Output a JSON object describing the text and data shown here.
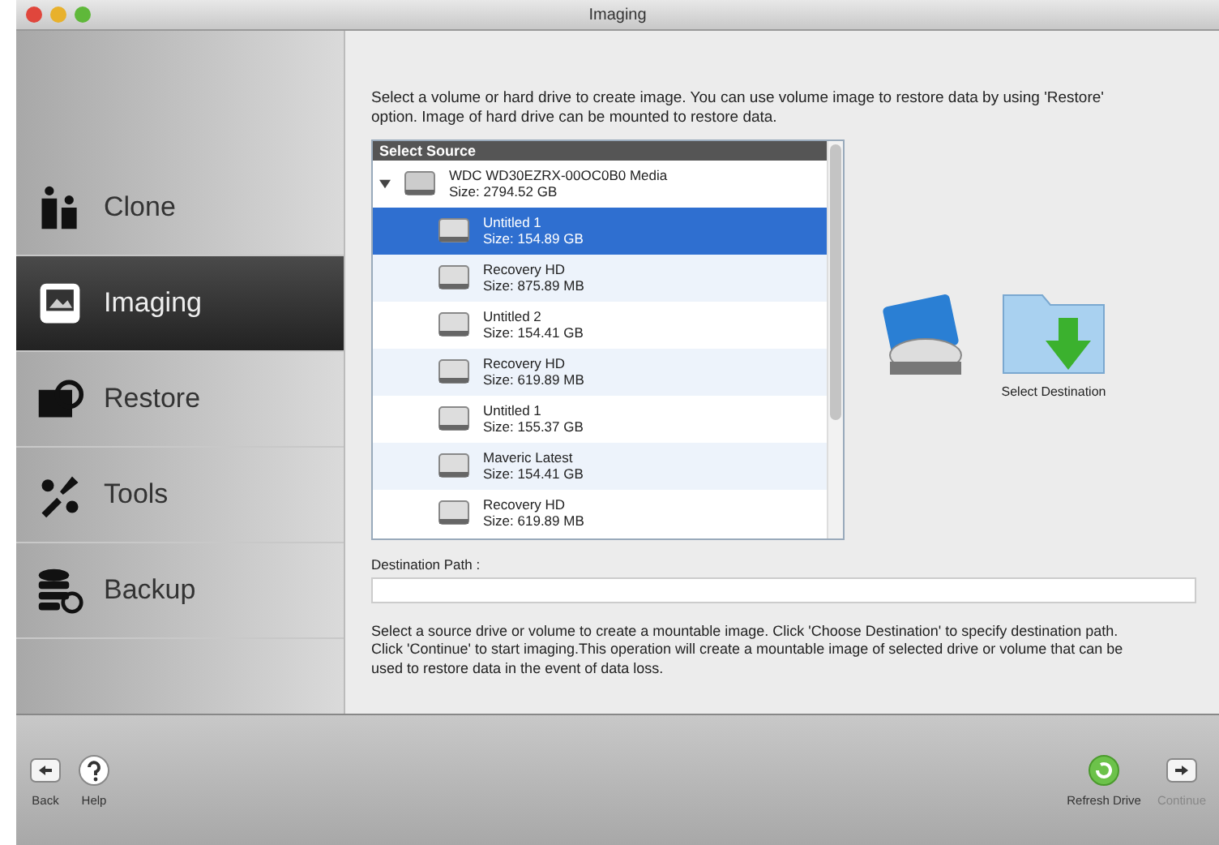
{
  "window": {
    "title": "Imaging"
  },
  "sidebar": {
    "items": [
      {
        "label": "Clone",
        "kind": "clone",
        "selected": false
      },
      {
        "label": "Imaging",
        "kind": "imaging",
        "selected": true
      },
      {
        "label": "Restore",
        "kind": "restore",
        "selected": false
      },
      {
        "label": "Tools",
        "kind": "tools",
        "selected": false
      },
      {
        "label": "Backup",
        "kind": "backup",
        "selected": false
      }
    ]
  },
  "intro": "Select a volume or hard drive to create image. You can use volume image to restore data by using 'Restore' option. Image of hard drive can be mounted to restore data.",
  "source_list": {
    "header": "Select Source",
    "items": [
      {
        "name": "WDC WD30EZRX-00OC0B0 Media",
        "size": "Size: 2794.52 GB",
        "expanded": true,
        "selected": false,
        "children": [
          {
            "name": "Untitled 1",
            "size": "Size: 154.89 GB",
            "selected": true
          },
          {
            "name": "Recovery HD",
            "size": "Size: 875.89 MB",
            "selected": false
          },
          {
            "name": "Untitled 2",
            "size": "Size: 154.41 GB",
            "selected": false
          },
          {
            "name": "Recovery HD",
            "size": "Size: 619.89 MB",
            "selected": false
          },
          {
            "name": "Untitled 1",
            "size": "Size: 155.37 GB",
            "selected": false
          },
          {
            "name": "Maveric Latest",
            "size": "Size: 154.41 GB",
            "selected": false
          },
          {
            "name": "Recovery HD",
            "size": "Size: 619.89 MB",
            "selected": false
          }
        ]
      }
    ]
  },
  "select_destination": {
    "label": "Select Destination"
  },
  "destination_path": {
    "label": "Destination Path :"
  },
  "help_text": "Select a source drive or volume to create a mountable image. Click 'Choose Destination' to specify destination path. Click 'Continue' to start imaging.This operation will create a mountable image of selected drive or volume that can be used to restore data in the event of data loss.",
  "toolbar": {
    "left": [
      {
        "label": "Back",
        "kind": "back",
        "disabled": false
      },
      {
        "label": "Help",
        "kind": "help",
        "disabled": false
      }
    ],
    "right": [
      {
        "label": "Refresh Drive",
        "kind": "refresh",
        "disabled": false
      },
      {
        "label": "Continue",
        "kind": "continue",
        "disabled": true
      }
    ]
  }
}
